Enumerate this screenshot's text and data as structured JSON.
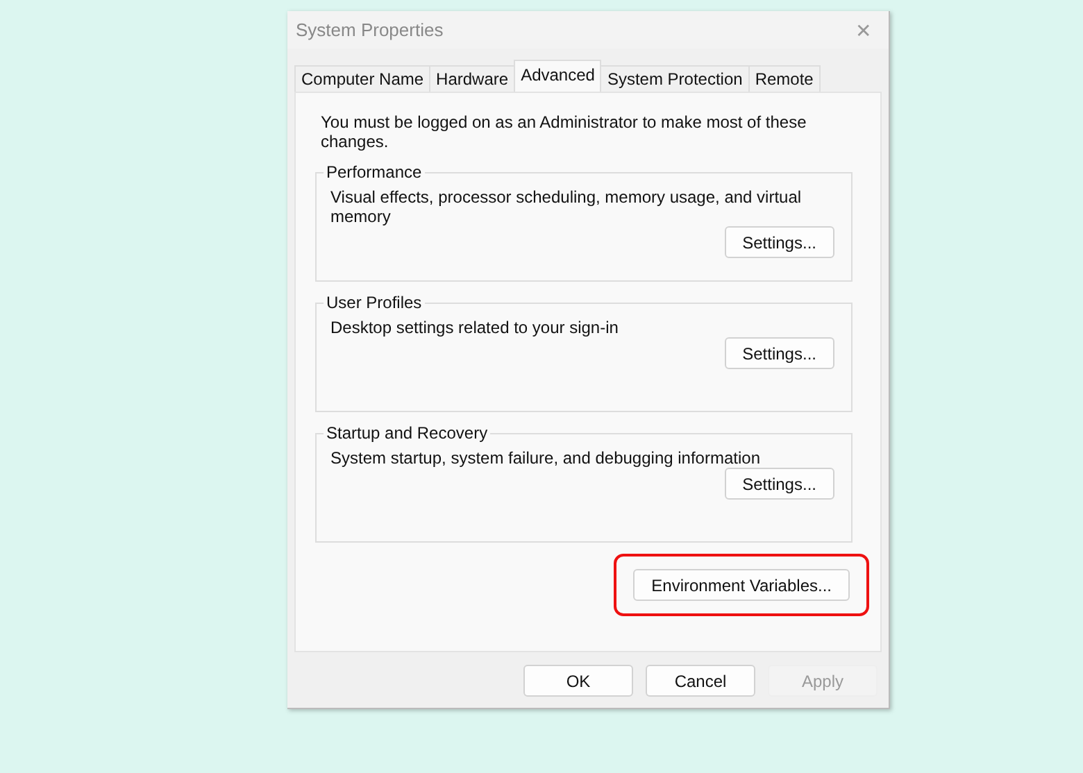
{
  "window": {
    "title": "System Properties",
    "close": "✕"
  },
  "tabs": [
    {
      "label": "Computer Name",
      "selected": false
    },
    {
      "label": "Hardware",
      "selected": false
    },
    {
      "label": "Advanced",
      "selected": true
    },
    {
      "label": "System Protection",
      "selected": false
    },
    {
      "label": "Remote",
      "selected": false
    }
  ],
  "notice": "You must be logged on as an Administrator to make most of these changes.",
  "groups": [
    {
      "title": "Performance",
      "description": "Visual effects, processor scheduling, memory usage, and virtual memory",
      "button": "Settings..."
    },
    {
      "title": "User Profiles",
      "description": "Desktop settings related to your sign-in",
      "button": "Settings..."
    },
    {
      "title": "Startup and Recovery",
      "description": "System startup, system failure, and debugging information",
      "button": "Settings..."
    }
  ],
  "environment_button": {
    "label": "Environment Variables...",
    "highlighted": true
  },
  "buttons": [
    {
      "label": "OK",
      "disabled": false
    },
    {
      "label": "Cancel",
      "disabled": false
    },
    {
      "label": "Apply",
      "disabled": true
    }
  ]
}
